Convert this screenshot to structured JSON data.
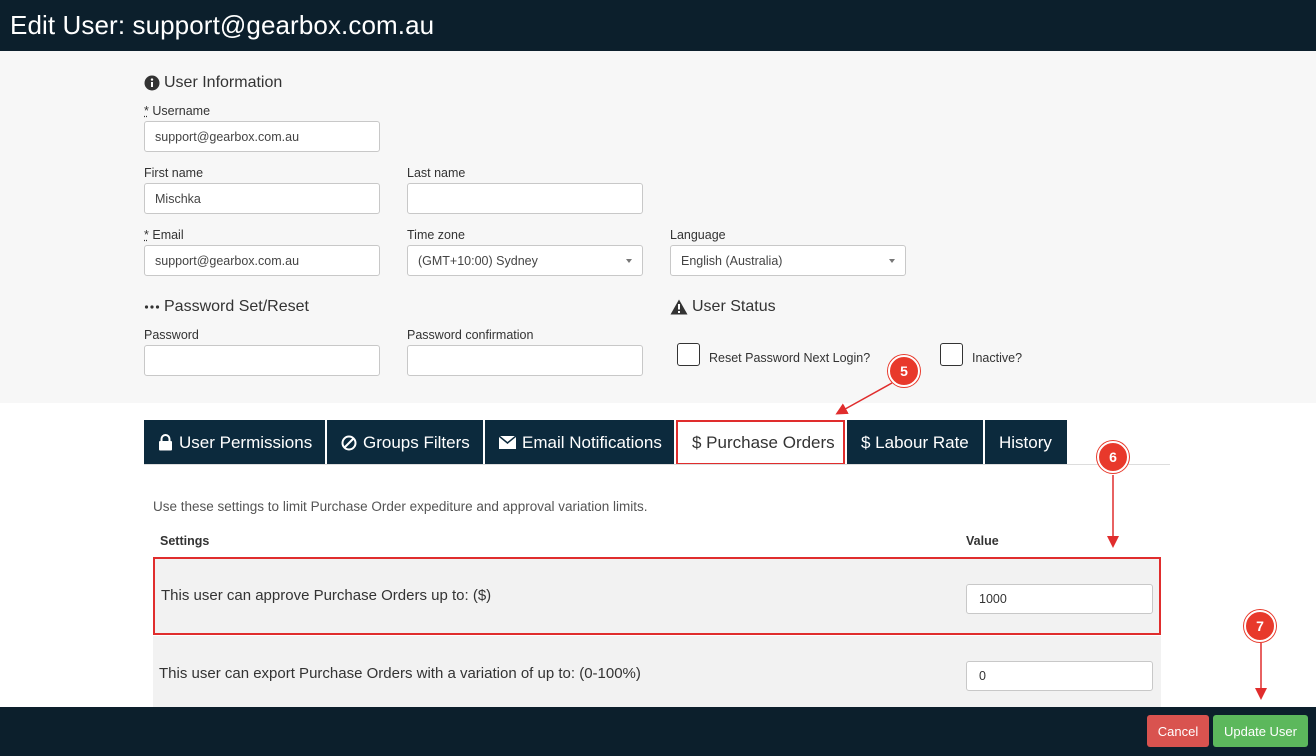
{
  "header": {
    "title": "Edit User: support@gearbox.com.au"
  },
  "user_info": {
    "heading": "User Information",
    "username": {
      "label": "Username",
      "required_mark": "*",
      "value": "support@gearbox.com.au"
    },
    "first_name": {
      "label": "First name",
      "value": "Mischka"
    },
    "last_name": {
      "label": "Last name",
      "value": ""
    },
    "email": {
      "label": "Email",
      "required_mark": "*",
      "value": "support@gearbox.com.au"
    },
    "time_zone": {
      "label": "Time zone",
      "value": "(GMT+10:00) Sydney"
    },
    "language": {
      "label": "Language",
      "value": "English (Australia)"
    }
  },
  "password": {
    "heading": "Password Set/Reset",
    "password_label": "Password",
    "confirmation_label": "Password confirmation"
  },
  "user_status": {
    "heading": "User Status",
    "reset_label": "Reset Password Next Login?",
    "inactive_label": "Inactive?"
  },
  "tabs": [
    {
      "label": "User Permissions",
      "icon": "lock-icon"
    },
    {
      "label": "Groups Filters",
      "icon": "ban-icon"
    },
    {
      "label": "Email Notifications",
      "icon": "envelope-icon"
    },
    {
      "label": "$ Purchase Orders",
      "active": true
    },
    {
      "label": "$ Labour Rate"
    },
    {
      "label": "History"
    }
  ],
  "purchase_orders": {
    "intro": "Use these settings to limit Purchase Order expediture and approval variation limits.",
    "col_settings": "Settings",
    "col_value": "Value",
    "rows": [
      {
        "label": "This user can approve Purchase Orders up to: ($)",
        "value": "1000"
      },
      {
        "label": "This user can export Purchase Orders with a variation of up to: (0-100%)",
        "value": "0"
      }
    ]
  },
  "footer": {
    "cancel": "Cancel",
    "update": "Update User"
  },
  "annotations": {
    "m5": "5",
    "m6": "6",
    "m7": "7"
  },
  "colors": {
    "navy": "#0c1f2c",
    "tab_navy": "#0c2a3d",
    "highlight_red": "#e02d2d",
    "cancel_red": "#d9534f",
    "update_green": "#5cb85c"
  }
}
